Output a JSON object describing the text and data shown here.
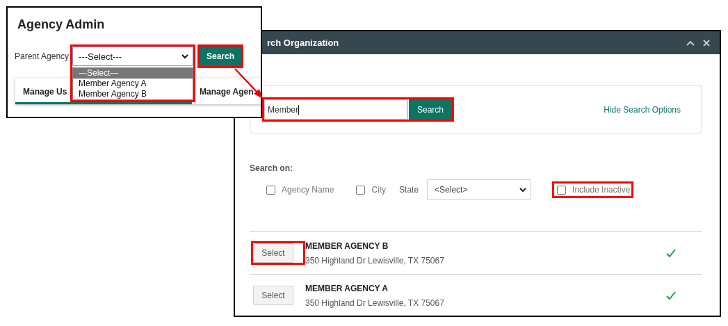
{
  "admin_window": {
    "title": "Agency Admin",
    "parent_agency": {
      "label": "Parent Agency",
      "value": "---Select---",
      "highlighted": true
    },
    "search_button": {
      "label": "Search",
      "highlighted": true
    },
    "dropdown_options": [
      {
        "label": "---Select---",
        "selected": true
      },
      {
        "label": "Member Agency A",
        "selected": false
      },
      {
        "label": "Member Agency B",
        "selected": false
      }
    ],
    "tabs": [
      {
        "label": "Manage Us",
        "selected": true
      },
      {
        "label": "Manage Agen",
        "selected": false
      }
    ]
  },
  "search_window": {
    "title": "rch Organization",
    "search": {
      "value": "Member",
      "button": "Search",
      "highlighted": true
    },
    "hide_options_link": "Hide Search Options",
    "search_on_label": "Search on:",
    "options": [
      {
        "kind": "checkbox",
        "label": "Agency Name",
        "checked": false,
        "highlighted": false
      },
      {
        "kind": "checkbox",
        "label": "City",
        "checked": false,
        "highlighted": false
      },
      {
        "kind": "select",
        "label": "State",
        "value": "<Select>"
      },
      {
        "kind": "checkbox",
        "label": "Include Inactive",
        "checked": false,
        "highlighted": true
      }
    ],
    "results": [
      {
        "button": "Select",
        "name": "MEMBER AGENCY B",
        "address": "350 Highland Dr Lewisville, TX 75067",
        "active": true,
        "highlighted": true
      },
      {
        "button": "Select",
        "name": "MEMBER AGENCY A",
        "address": "350 Highland Dr Lewisville, TX 75067",
        "active": true,
        "highlighted": false
      }
    ]
  }
}
